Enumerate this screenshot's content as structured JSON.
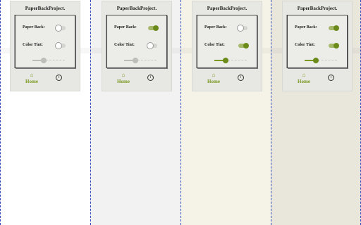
{
  "panels": [
    {
      "theme": "white",
      "title": "PaperBackProject.",
      "paper_back_label": "Paper Back:",
      "paper_back_on": false,
      "color_tint_label": "Color Tint:",
      "color_tint_on": false,
      "tint_level": 0.35,
      "nav": {
        "home_label": "Home"
      }
    },
    {
      "theme": "light-gray",
      "title": "PaperBackProject.",
      "paper_back_label": "Paper Back:",
      "paper_back_on": true,
      "color_tint_label": "Color Tint:",
      "color_tint_on": false,
      "tint_level": 0.35,
      "nav": {
        "home_label": "Home"
      }
    },
    {
      "theme": "cream",
      "title": "PaperBackProject.",
      "paper_back_label": "Paper Back:",
      "paper_back_on": false,
      "color_tint_label": "Color Tint:",
      "color_tint_on": true,
      "tint_level": 0.35,
      "nav": {
        "home_label": "Home"
      }
    },
    {
      "theme": "beige",
      "title": "PaperBackProject.",
      "paper_back_label": "Paper Back:",
      "paper_back_on": true,
      "color_tint_label": "Color Tint:",
      "color_tint_on": true,
      "tint_level": 0.35,
      "nav": {
        "home_label": "Home"
      }
    }
  ],
  "colors": {
    "accent": "#6a8a1a",
    "divider": "#2f47b8",
    "backgrounds": [
      "#ffffff",
      "#f2f2f2",
      "#f5f3e8",
      "#e9e6dc"
    ]
  },
  "icons": {
    "home": "home-icon",
    "info": "info-icon"
  }
}
